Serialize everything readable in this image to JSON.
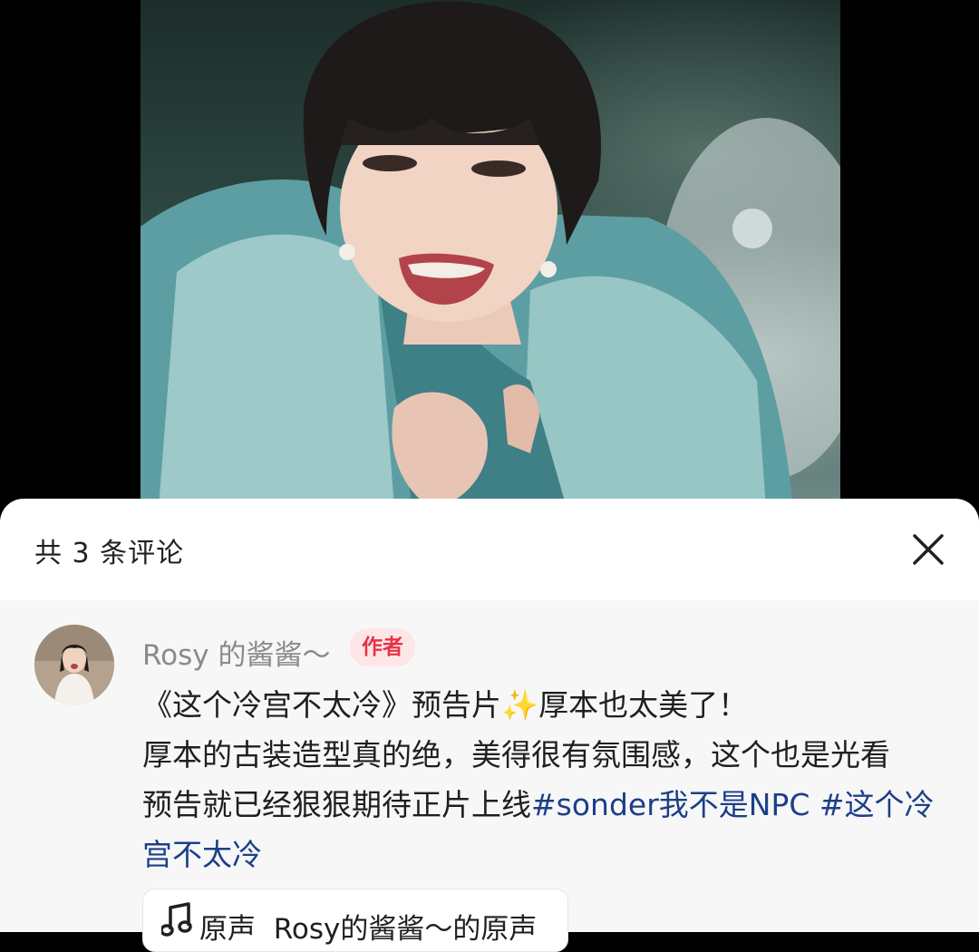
{
  "sheet": {
    "title": "共 3 条评论",
    "close_icon": "close-icon"
  },
  "comment": {
    "username": "Rosy 的酱酱～",
    "badge": "作者",
    "text": {
      "part1": "《这个冷宫不太冷》预告片",
      "sparkle": "✨",
      "part2": "厚本也太美了！",
      "line2": "厚本的古装造型真的绝，美得很有氛围感，这个也是光看",
      "part3": "预告就已经狠狠期待正片上线",
      "hashtag1": "#sonder我不是NPC",
      "space": " ",
      "hashtag2": "#这个冷宫不太冷"
    },
    "sound": {
      "icon": "music-note-icon",
      "label": "原声",
      "value": "Rosy的酱酱～的原声"
    }
  },
  "colors": {
    "hashtag": "#1c3f87",
    "badge_text": "#e63344",
    "badge_bg": "#fde6e8"
  }
}
